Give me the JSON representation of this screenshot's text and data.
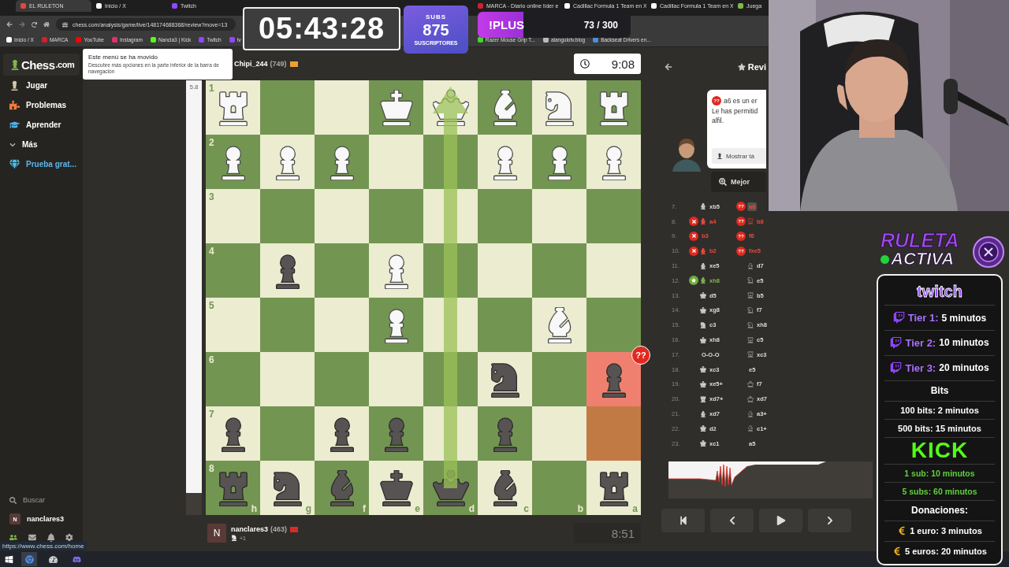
{
  "browser": {
    "tabs": [
      {
        "label": "EL RULETON",
        "color": "#e8453c",
        "selected": true
      },
      {
        "label": "Inicio / X",
        "color": "#ffffff",
        "selected": false
      },
      {
        "label": "Twitch",
        "color": "#9146ff",
        "selected": false
      },
      {
        "label": "MARCA - Diario online líder e",
        "color": "#d0202e",
        "selected": false
      },
      {
        "label": "Cadillac Formula 1 Team en X",
        "color": "#ffffff",
        "selected": false
      },
      {
        "label": "Cadillac Formula 1 Team en X",
        "color": "#ffffff",
        "selected": false
      },
      {
        "label": "Juega",
        "color": "#81b64c",
        "selected": false
      }
    ],
    "address": "chess.com/analysis/game/live/148174688368/review?move=13",
    "bookmarks_left": [
      {
        "label": "Inicio / X",
        "color": "#ffffff"
      },
      {
        "label": "MARCA",
        "color": "#d0202e"
      },
      {
        "label": "YouTube",
        "color": "#ff0000"
      },
      {
        "label": "Instagram",
        "color": "#e1306c"
      },
      {
        "label": "Nancla3 | Kick",
        "color": "#53fc18"
      },
      {
        "label": "Twitch",
        "color": "#9146ff"
      },
      {
        "label": "tv",
        "color": "#9146ff"
      }
    ],
    "bookmarks_right": [
      {
        "label": "Razer Mouse Grip T...",
        "color": "#44d62c"
      },
      {
        "label": "alangulotv.blog",
        "color": "#bbbbbb"
      },
      {
        "label": "Backseat Drivers en...",
        "color": "#4a90d9"
      }
    ]
  },
  "stream": {
    "timer": "05:43:28",
    "subs": {
      "label": "SUBS",
      "count": "875",
      "caption": "SUSCRIPTORES"
    },
    "plus": {
      "label": "!PLUS",
      "progress": "73 / 300",
      "level": 0.3
    }
  },
  "sidebar": {
    "logo": "Chess",
    "logo_suffix": ".com",
    "items": [
      {
        "kind": "play",
        "label": "Jugar"
      },
      {
        "kind": "puzzles",
        "label": "Problemas"
      },
      {
        "kind": "learn",
        "label": "Aprender"
      },
      {
        "kind": "more",
        "label": "Más"
      },
      {
        "kind": "trial",
        "label": "Prueba grat..."
      }
    ],
    "search": "Buscar",
    "user": {
      "initial": "N",
      "name": "nanclares3"
    },
    "status_url": "https://www.chess.com/home"
  },
  "tooltip": {
    "title": "Este menú se ha movido",
    "body": "Descubre más opciones en la parte inferior de la barra de navegación"
  },
  "eval_bar": {
    "label": "5.8",
    "level": 0.95
  },
  "top_player": {
    "name": "Chipi_244",
    "rating": "(749)",
    "clock": "9:08"
  },
  "bottom_player": {
    "initial": "N",
    "name": "nanclares3",
    "rating": "(463)",
    "material": "+1",
    "clock": "8:51"
  },
  "board": {
    "files": [
      "h",
      "g",
      "f",
      "e",
      "d",
      "c",
      "b",
      "a"
    ],
    "arrow": true,
    "ranks": [
      {
        "label": "1",
        "squares": [
          {
            "kind": "rook",
            "white": true
          },
          {
            "kind": "empty"
          },
          {
            "kind": "empty"
          },
          {
            "kind": "king",
            "white": true
          },
          {
            "kind": "queen",
            "white": true
          },
          {
            "kind": "bishop",
            "white": true
          },
          {
            "kind": "knight",
            "white": true
          },
          {
            "kind": "rook",
            "white": true
          }
        ]
      },
      {
        "label": "2",
        "squares": [
          {
            "kind": "pawn",
            "white": true
          },
          {
            "kind": "pawn",
            "white": true
          },
          {
            "kind": "pawn",
            "white": true
          },
          {
            "kind": "empty"
          },
          {
            "kind": "empty"
          },
          {
            "kind": "pawn",
            "white": true
          },
          {
            "kind": "pawn",
            "white": true
          },
          {
            "kind": "pawn",
            "white": true
          }
        ]
      },
      {
        "label": "3",
        "squares": [
          {
            "kind": "empty"
          },
          {
            "kind": "empty"
          },
          {
            "kind": "empty"
          },
          {
            "kind": "empty"
          },
          {
            "kind": "empty"
          },
          {
            "kind": "empty"
          },
          {
            "kind": "empty"
          },
          {
            "kind": "empty"
          }
        ]
      },
      {
        "label": "4",
        "squares": [
          {
            "kind": "empty"
          },
          {
            "kind": "pawn",
            "white": false
          },
          {
            "kind": "empty"
          },
          {
            "kind": "pawn",
            "white": true
          },
          {
            "kind": "empty"
          },
          {
            "kind": "empty"
          },
          {
            "kind": "empty"
          },
          {
            "kind": "empty"
          }
        ]
      },
      {
        "label": "5",
        "squares": [
          {
            "kind": "empty"
          },
          {
            "kind": "empty"
          },
          {
            "kind": "empty"
          },
          {
            "kind": "pawn",
            "white": true
          },
          {
            "kind": "empty"
          },
          {
            "kind": "empty"
          },
          {
            "kind": "bishop",
            "white": true
          },
          {
            "kind": "empty"
          }
        ]
      },
      {
        "label": "6",
        "squares": [
          {
            "kind": "empty"
          },
          {
            "kind": "empty"
          },
          {
            "kind": "empty"
          },
          {
            "kind": "empty"
          },
          {
            "kind": "empty"
          },
          {
            "kind": "knight",
            "white": false
          },
          {
            "kind": "empty"
          },
          {
            "kind": "pawn",
            "white": false,
            "highlight": {
              "kind": "blunder",
              "badge": "??"
            }
          }
        ]
      },
      {
        "label": "7",
        "squares": [
          {
            "kind": "pawn",
            "white": false
          },
          {
            "kind": "empty"
          },
          {
            "kind": "pawn",
            "white": false
          },
          {
            "kind": "pawn",
            "white": false
          },
          {
            "kind": "empty"
          },
          {
            "kind": "pawn",
            "white": false
          },
          {
            "kind": "empty"
          },
          {
            "kind": "empty",
            "highlight": {
              "kind": "last_move"
            }
          }
        ]
      },
      {
        "label": "8",
        "squares": [
          {
            "kind": "rook",
            "white": false
          },
          {
            "kind": "knight",
            "white": false
          },
          {
            "kind": "bishop",
            "white": false
          },
          {
            "kind": "king",
            "white": false
          },
          {
            "kind": "queen",
            "white": false
          },
          {
            "kind": "bishop",
            "white": false
          },
          {
            "kind": "empty"
          },
          {
            "kind": "rook",
            "white": false
          }
        ]
      }
    ]
  },
  "review": {
    "title": "Revi",
    "coach": {
      "badge": "??",
      "lines": [
        "a6 es un er",
        "Le has permitid",
        "alfil."
      ],
      "button": "Mostrar tá"
    },
    "best_button": "Mejor",
    "moves": [
      {
        "number": "7.",
        "white": {
          "piece": {
            "kind": "bishop"
          },
          "san": "xb5",
          "selected": false
        },
        "black": {
          "san": "a6",
          "badge": {
            "kind": "blunder",
            "text": "??"
          },
          "selected": true
        }
      },
      {
        "number": "8.",
        "white": {
          "piece": {
            "kind": "bishop"
          },
          "san": "a4",
          "badge": {
            "kind": "mistake"
          },
          "selected": false
        },
        "black": {
          "piece": {
            "kind": "rook"
          },
          "san": "b8",
          "badge": {
            "kind": "blunder",
            "text": "??"
          },
          "selected": false
        }
      },
      {
        "number": "9.",
        "white": {
          "san": "b3",
          "badge": {
            "kind": "mistake"
          },
          "selected": false
        },
        "black": {
          "san": "f6",
          "badge": {
            "kind": "blunder",
            "text": "??"
          },
          "selected": false
        }
      },
      {
        "number": "10.",
        "white": {
          "piece": {
            "kind": "bishop"
          },
          "san": "b2",
          "badge": {
            "kind": "mistake"
          },
          "selected": false
        },
        "black": {
          "san": "fxe5",
          "badge": {
            "kind": "blunder",
            "text": "??"
          },
          "selected": false
        }
      },
      {
        "number": "11.",
        "white": {
          "piece": {
            "kind": "bishop"
          },
          "san": "xe5",
          "selected": false
        },
        "black": {
          "piece": {
            "kind": "bishop"
          },
          "san": "d7",
          "selected": false
        }
      },
      {
        "number": "12.",
        "white": {
          "piece": {
            "kind": "bishop"
          },
          "san": "xh8",
          "badge": {
            "kind": "best"
          },
          "selected": false
        },
        "black": {
          "piece": {
            "kind": "knight"
          },
          "san": "e5",
          "selected": false
        }
      },
      {
        "number": "13.",
        "white": {
          "piece": {
            "kind": "queen"
          },
          "san": "d5",
          "selected": false
        },
        "black": {
          "piece": {
            "kind": "rook"
          },
          "san": "b5",
          "selected": false
        }
      },
      {
        "number": "14.",
        "white": {
          "piece": {
            "kind": "queen"
          },
          "san": "xg8",
          "selected": false
        },
        "black": {
          "piece": {
            "kind": "knight"
          },
          "san": "f7",
          "selected": false
        }
      },
      {
        "number": "15.",
        "white": {
          "piece": {
            "kind": "knight"
          },
          "san": "c3",
          "selected": false
        },
        "black": {
          "piece": {
            "kind": "knight"
          },
          "san": "xh8",
          "selected": false
        }
      },
      {
        "number": "16.",
        "white": {
          "piece": {
            "kind": "queen"
          },
          "san": "xh8",
          "selected": false
        },
        "black": {
          "piece": {
            "kind": "rook"
          },
          "san": "c5",
          "selected": false
        }
      },
      {
        "number": "17.",
        "white": {
          "san": "O-O-O",
          "selected": false
        },
        "black": {
          "piece": {
            "kind": "rook"
          },
          "san": "xc3",
          "selected": false
        }
      },
      {
        "number": "18.",
        "white": {
          "piece": {
            "kind": "queen"
          },
          "san": "xc3",
          "selected": false
        },
        "black": {
          "san": "e5",
          "selected": false
        }
      },
      {
        "number": "19.",
        "white": {
          "piece": {
            "kind": "queen"
          },
          "san": "xe5+",
          "selected": false
        },
        "black": {
          "piece": {
            "kind": "king"
          },
          "san": "f7",
          "selected": false
        }
      },
      {
        "number": "20.",
        "white": {
          "piece": {
            "kind": "rook"
          },
          "san": "xd7+",
          "selected": false
        },
        "black": {
          "piece": {
            "kind": "king"
          },
          "san": "xd7",
          "selected": false
        }
      },
      {
        "number": "21.",
        "white": {
          "piece": {
            "kind": "bishop"
          },
          "san": "xd7",
          "selected": false
        },
        "black": {
          "piece": {
            "kind": "bishop"
          },
          "san": "a3+",
          "selected": false
        }
      },
      {
        "number": "22.",
        "white": {
          "piece": {
            "kind": "king"
          },
          "san": "d2",
          "selected": false
        },
        "black": {
          "piece": {
            "kind": "bishop"
          },
          "san": "c1+",
          "selected": false
        }
      },
      {
        "number": "23.",
        "white": {
          "piece": {
            "kind": "king"
          },
          "san": "xc1",
          "selected": false
        },
        "black": {
          "san": "a5",
          "selected": false
        }
      }
    ]
  },
  "ruleta": {
    "title": "RULETA",
    "subtitle": "ACTIVA",
    "active": true,
    "rows": [
      {
        "kind": "logo",
        "text": "twitch"
      },
      {
        "kind": "tier",
        "label": "Tier 1:",
        "value": "5 minutos"
      },
      {
        "kind": "tier",
        "label": "Tier 2:",
        "value": "10 minutos"
      },
      {
        "kind": "tier",
        "label": "Tier 3:",
        "value": "20 minutos"
      },
      {
        "kind": "heading",
        "text": "Bits"
      },
      {
        "kind": "plain",
        "text": "100 bits: 2 minutos"
      },
      {
        "kind": "plain",
        "text": "500 bits: 15 minutos"
      },
      {
        "kind": "kick_logo",
        "text": "KICK"
      },
      {
        "kind": "kick",
        "text": "1 sub: 10 minutos"
      },
      {
        "kind": "kick",
        "text": "5 subs: 60 minutos"
      },
      {
        "kind": "heading",
        "text": "Donaciones:"
      },
      {
        "kind": "donation",
        "text": "1 euro: 3 minutos"
      },
      {
        "kind": "donation",
        "text": "5 euros: 20 minutos"
      }
    ]
  }
}
